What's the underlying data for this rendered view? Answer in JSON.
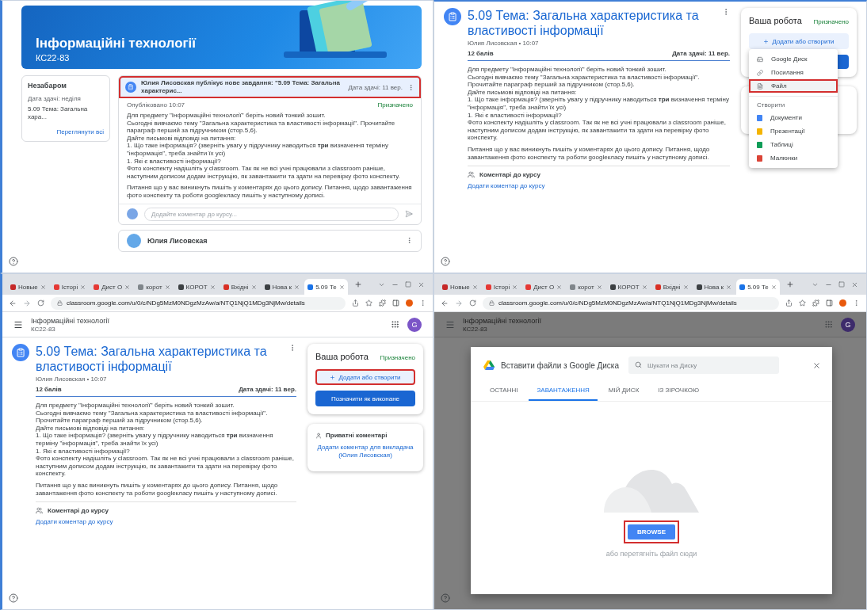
{
  "panels": [
    {
      "kind": "stream",
      "banner": {
        "title": "Інформаційні технології",
        "subtitle": "КС22-83"
      },
      "upcoming": {
        "title": "Незабаром",
        "due": "Дата здачі: неділя",
        "item": "5.09 Тема: Загальна хара...",
        "link": "Переглянути всі"
      },
      "post": {
        "headline": "Юлия Лисовская публікує нове завдання: \"5.09 Тема: Загальна характерис...",
        "due": "Дата здачі: 11 вер.",
        "highlighted": true,
        "published": "Опубліковано 10:07",
        "status": "Призначено",
        "body": [
          "Для предмету \"Інформаційні технології\" беріть новий тонкий зошит.",
          "Сьогодні вивчаємо тему \"Загальна характеристика та властивості інформації\". Прочитайте параграф перший за підручником (стор.5,6).",
          "Дайте письмові відповіді на питання:",
          "1. Що таке інформація? (зверніть увагу у підручнику наводиться **три** визначення терміну \"інформація\", треба знайти їх усі)",
          "1. Які є властивості інформації?",
          "Фото конспекту надішліть у classroom. Так як не всі учні працювали з classroom раніше, наступним дописом додам інструкцію, як завантажити та здати на перевірку фото конспекту."
        ],
        "note": "Питання що у вас виникнуть пишіть у коментарях до цього допису. Питання, щодо завантаження фото конспекту та роботи googleкласу пишіть у наступному дописі.",
        "comment_placeholder": "Додайте коментар до курсу..."
      },
      "next_post": {
        "author": "Юлия Лисовская"
      }
    },
    {
      "kind": "details",
      "assignment": {
        "title": "5.09 Тема: Загальна характеристика та властивості інформації",
        "meta": "Юлия Лисовская • 10:07",
        "points": "12 балів",
        "due": "Дата здачі: 11 вер.",
        "body": [
          "Для предмету \"Інформаційні технології\" беріть новий тонкий зошит.",
          "Сьогодні вивчаємо тему \"Загальна характеристика та властивості інформації\". Прочитайте параграф перший за підручником (стор.5,6).",
          "Дайте письмові відповіді на питання:",
          "1. Що таке інформація? (зверніть увагу у підручнику наводиться **три** визначення терміну \"інформація\", треба знайти їх усі)",
          "1. Які є властивості інформації?",
          "Фото конспекту надішліть у classroom. Так як не всі учні працювали з classroom раніше, наступним дописом додам інструкцію, як завантажити та здати на перевірку фото конспекту."
        ],
        "note": "Питання що у вас виникнуть пишіть у коментарях до цього допису. Питання, щодо завантаження фото конспекту та роботи googleкласу пишіть у наступному дописі.",
        "comments_label": "Коментарі до курсу",
        "comments_link": "Додати коментар до курсу"
      },
      "work": {
        "title": "Ваша робота",
        "status": "Призначено",
        "add_button": {
          "label": "Додати або створити",
          "highlighted": false
        },
        "covered_button": true,
        "menu": {
          "items": [
            {
              "kind": "drive",
              "label": "Google Диск",
              "highlighted": false
            },
            {
              "kind": "link",
              "label": "Посилання",
              "highlighted": false
            },
            {
              "kind": "file",
              "label": "Файл",
              "highlighted": true
            }
          ],
          "section": "Створити",
          "create": [
            {
              "kind": "docs",
              "label": "Документи"
            },
            {
              "kind": "slides",
              "label": "Презентації"
            },
            {
              "kind": "sheets",
              "label": "Таблиці"
            },
            {
              "kind": "drawings",
              "label": "Малюнки"
            }
          ]
        }
      }
    },
    {
      "kind": "details",
      "browser": {
        "tabs": [
          {
            "label": "Новые",
            "color": "#c62828",
            "selected": false
          },
          {
            "label": "Історі",
            "color": "#e53935",
            "selected": false
          },
          {
            "label": "Дист О",
            "color": "#e53935",
            "selected": false
          },
          {
            "label": "корот",
            "color": "#80868b",
            "selected": false
          },
          {
            "label": "КОРОТ",
            "color": "#3c4043",
            "selected": false
          },
          {
            "label": "Вхідні",
            "color": "#d93025",
            "selected": false
          },
          {
            "label": "Нова к",
            "color": "#3c4043",
            "selected": false
          },
          {
            "label": "5.09 Те",
            "color": "#1a73e8",
            "selected": true
          }
        ],
        "url": "classroom.google.com/u/0/c/NDg5MzM0NDgzMzAw/a/NTQ1NjQ1MDg3NjMw/details"
      },
      "header": {
        "title": "Інформаційні технології",
        "subtitle": "КС22-83",
        "avatar": "G"
      },
      "assignment": {
        "title": "5.09 Тема: Загальна характеристика та властивості інформації",
        "meta": "Юлия Лисовская • 10:07",
        "points": "12 балів",
        "due": "Дата здачі: 11 вер.",
        "body": [
          "Для предмету \"Інформаційні технології\" беріть новий тонкий зошит.",
          "Сьогодні вивчаємо тему \"Загальна характеристика та властивості інформації\". Прочитайте параграф перший за підручником (стор.5,6).",
          "Дайте письмові відповіді на питання:",
          "1. Що таке інформація? (зверніть увагу у підручнику наводиться **три** визначення терміну \"інформація\", треба знайти їх усі)",
          "1. Які є властивості інформації?",
          "Фото конспекту надішліть у classroom. Так як не всі учні працювали з classroom раніше, наступним дописом додам інструкцію, як завантажити та здати на перевірку фото конспекту."
        ],
        "note": "Питання що у вас виникнуть пишіть у коментарях до цього допису. Питання, щодо завантаження фото конспекту та роботи googleкласу пишіть у наступному дописі.",
        "comments_label": "Коментарі до курсу",
        "comments_link": "Додати коментар до курсу"
      },
      "work": {
        "title": "Ваша робота",
        "status": "Призначено",
        "add_button": {
          "label": "Додати або створити",
          "highlighted": true
        },
        "done_button": "Позначити як виконане",
        "private": {
          "title": "Приватні коментарі",
          "link": "Додати коментар для викладача (Юлия Лисовская)"
        }
      }
    },
    {
      "kind": "picker",
      "browser": {
        "tabs": [
          {
            "label": "Новые",
            "color": "#c62828",
            "selected": false
          },
          {
            "label": "Історі",
            "color": "#e53935",
            "selected": false
          },
          {
            "label": "Дист О",
            "color": "#e53935",
            "selected": false
          },
          {
            "label": "корот",
            "color": "#80868b",
            "selected": false
          },
          {
            "label": "КОРОТ",
            "color": "#3c4043",
            "selected": false
          },
          {
            "label": "Вхідні",
            "color": "#d93025",
            "selected": false
          },
          {
            "label": "Нова к",
            "color": "#3c4043",
            "selected": false
          },
          {
            "label": "5.09 Те",
            "color": "#1a73e8",
            "selected": true
          }
        ],
        "url": "classroom.google.com/u/0/c/NDg5MzM0NDgzMzAw/a/NTQ1NjQ1MDg3NjMw/details"
      },
      "header": {
        "title": "Інформаційні технології",
        "subtitle": "КС22-83",
        "avatar": "G"
      },
      "dialog": {
        "title": "Вставити файли з Google Диска",
        "search_placeholder": "Шукати на Диску",
        "tabs": [
          {
            "label": "ОСТАННІ",
            "selected": false
          },
          {
            "label": "ЗАВАНТАЖЕННЯ",
            "selected": true
          },
          {
            "label": "МІЙ ДИСК",
            "selected": false
          },
          {
            "label": "ІЗ ЗІРОЧКОЮ",
            "selected": false
          }
        ],
        "browse": {
          "label": "BROWSE",
          "highlighted": true
        },
        "hint": "або перетягніть файл сюди"
      }
    }
  ]
}
